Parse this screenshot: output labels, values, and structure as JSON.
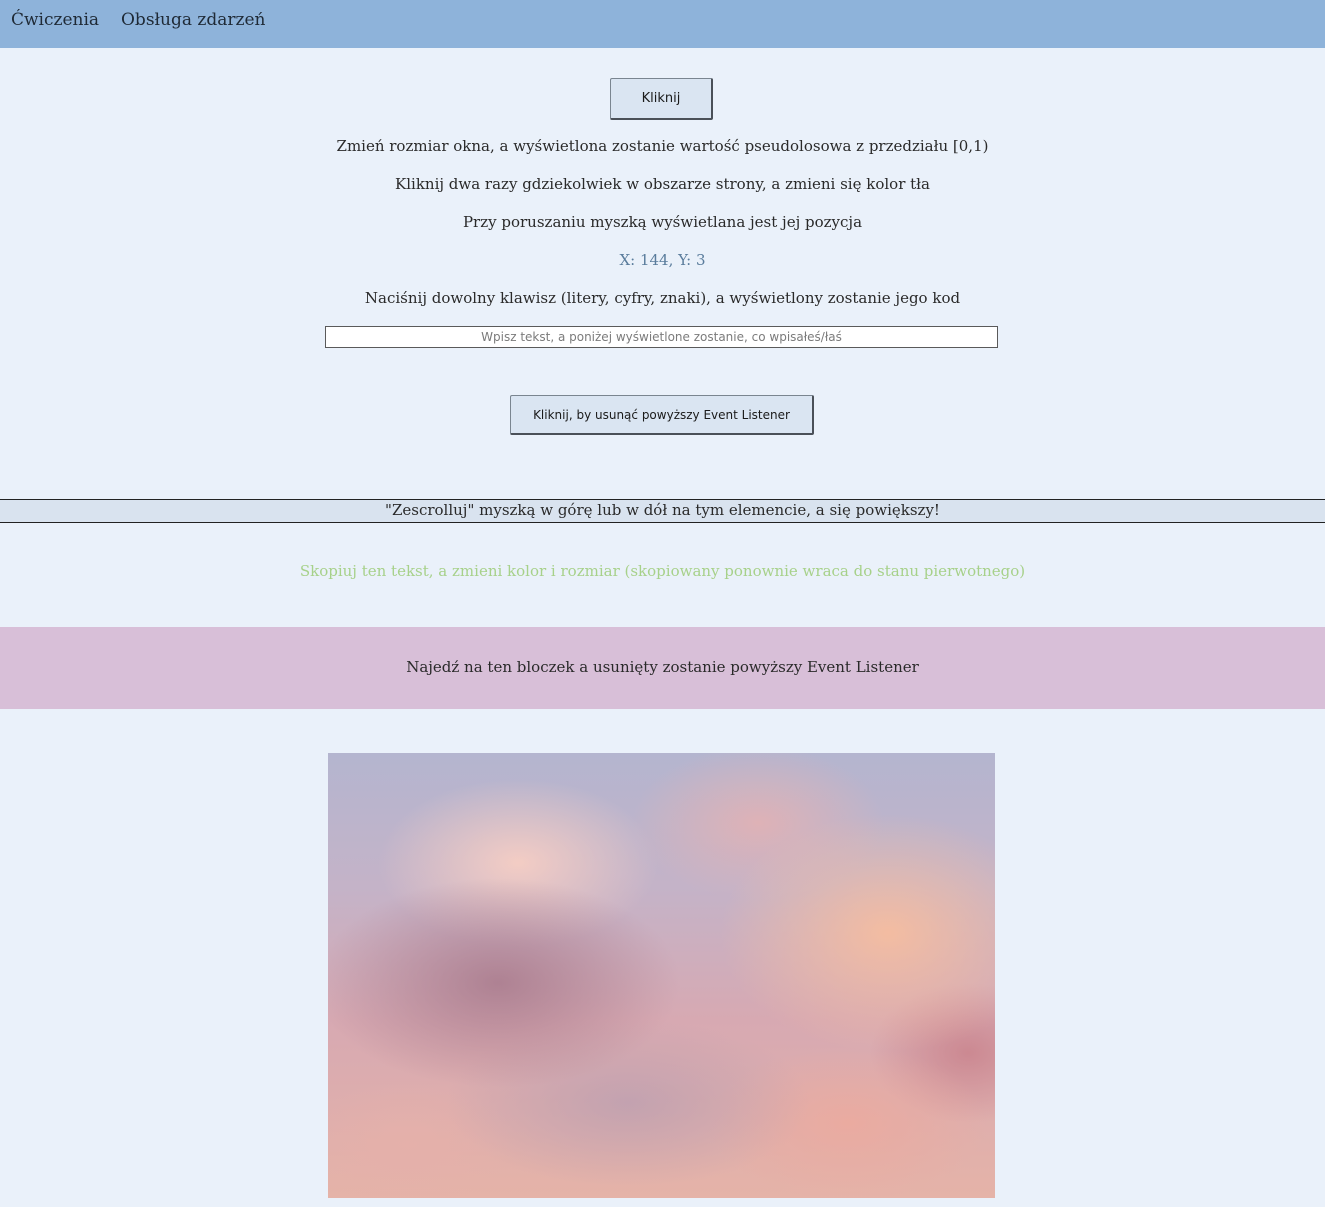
{
  "nav": {
    "items": [
      {
        "label": "Ćwiczenia"
      },
      {
        "label": "Obsługa zdarzeń"
      }
    ]
  },
  "main": {
    "click_button_label": "Kliknij",
    "resize_info": "Zmień rozmiar okna, a wyświetlona zostanie wartość pseudolosowa z przedziału [0,1)",
    "dblclick_info": "Kliknij dwa razy gdziekolwiek w obszarze strony, a zmieni się kolor tła",
    "mousemove_info": "Przy poruszaniu myszką wyświetlana jest jej pozycja",
    "mouse_position": "X: 144, Y: 3",
    "keypress_info": "Naciśnij dowolny klawisz (litery, cyfry, znaki), a wyświetlony zostanie jego kod",
    "text_input": {
      "value": "",
      "placeholder": "Wpisz tekst, a poniżej wyświetlone zostanie, co wpisałeś/łaś"
    },
    "remove_listener_button_label": "Kliknij, by usunąć powyższy Event Listener",
    "scroll_box_text": "\"Zescrolluj\" myszką w górę lub w dół na tym elemencie, a się powiększy!",
    "copy_text": "Skopiuj ten tekst, a zmieni kolor i rozmiar (skopiowany ponownie wraca do stanu pierwotnego)",
    "hover_block_text": "Najedź na ten bloczek a usunięty zostanie powyższy Event Listener"
  },
  "colors": {
    "navbar": "#8eb3da",
    "page_background": "#eaf1fa",
    "mouse_position_text": "#5a7c9c",
    "copy_text": "#a7d18a",
    "hover_block": "#d8bfd8"
  },
  "image": {
    "subject": "pink-sunset-clouds"
  }
}
